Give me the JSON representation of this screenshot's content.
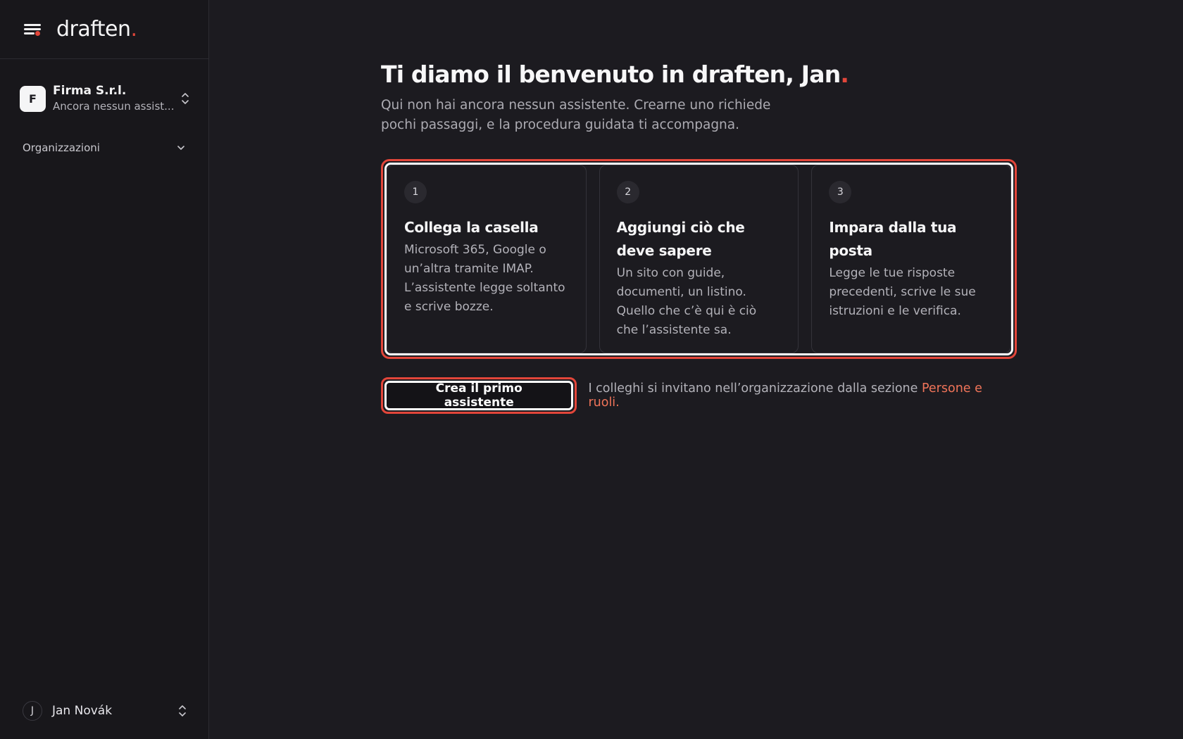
{
  "brand": {
    "name": "draften",
    "dot": ".",
    "accent_color": "#e2463a"
  },
  "sidebar": {
    "org": {
      "initial": "F",
      "name": "Firma S.r.l.",
      "subtitle": "Ancora nessun assist..."
    },
    "section_label": "Organizzazioni",
    "user": {
      "initial": "J",
      "name": "Jan Novák"
    }
  },
  "main": {
    "title": "Ti diamo il benvenuto in draften, Jan",
    "title_dot": ".",
    "subtitle": "Qui non hai ancora nessun assistente. Crearne uno richiede pochi passaggi, e la procedura guidata ti accompagna.",
    "steps": [
      {
        "number": "1",
        "title": "Collega la casella",
        "description": "Microsoft 365, Google o un’altra tramite IMAP. L’assistente legge soltanto e scrive bozze."
      },
      {
        "number": "2",
        "title": "Aggiungi ciò che deve sapere",
        "description": "Un sito con guide, documenti, un listino. Quello che c’è qui è ciò che l’assistente sa."
      },
      {
        "number": "3",
        "title": "Impara dalla tua posta",
        "description": "Legge le tue risposte precedenti, scrive le sue istruzioni e le verifica."
      }
    ],
    "cta_label": "Crea il primo assistente",
    "cta_note": "I colleghi si invitano nell’organizzazione dalla sezione ",
    "cta_link": "Persone e ruoli",
    "cta_note_end": "."
  }
}
